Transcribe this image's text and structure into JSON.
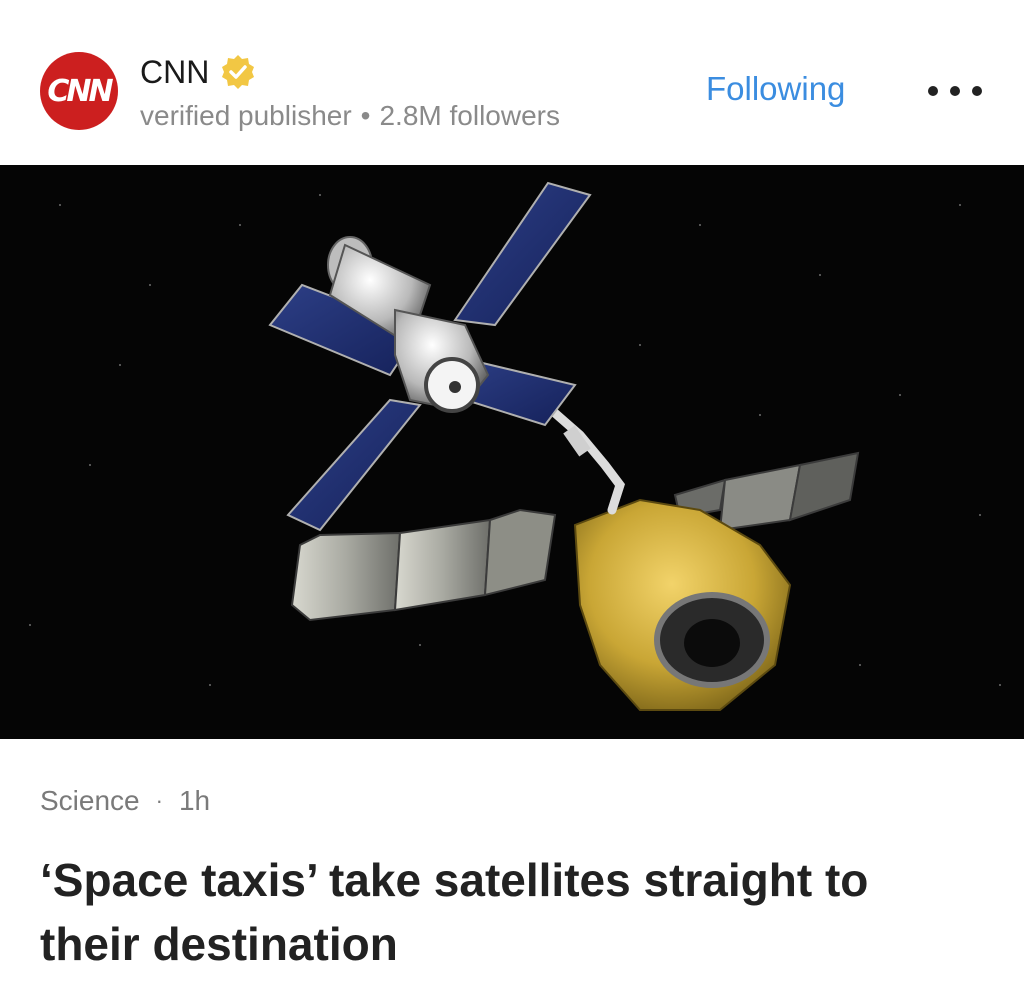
{
  "publisher": {
    "name": "CNN",
    "logo_text": "CNN",
    "subtitle": "verified publisher",
    "separator": "•",
    "followers": "2.8M followers",
    "verified_icon": "verified-badge-icon",
    "brand_color": "#cc1f1f",
    "badge_color": "#f2c744"
  },
  "actions": {
    "follow_label": "Following",
    "follow_color": "#3b8de0",
    "more_icon": "more-horizontal-icon"
  },
  "article": {
    "category": "Science",
    "separator": "·",
    "time": "1h",
    "headline": "‘Space taxis’ take satellites straight to their destination"
  }
}
